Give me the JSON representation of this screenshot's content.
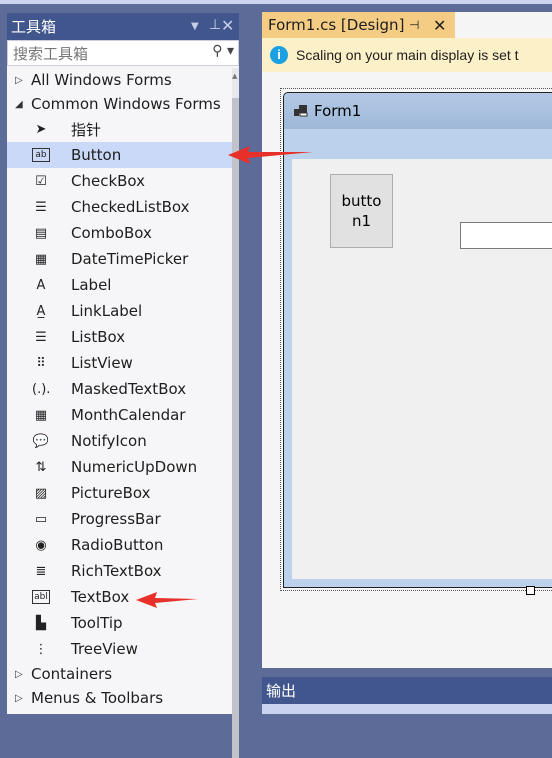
{
  "toolbox": {
    "title": "工具箱",
    "search_placeholder": "搜索工具箱",
    "groups_top": [
      {
        "label": "All Windows Forms",
        "expanded": false
      },
      {
        "label": "Common Windows Forms",
        "expanded": true
      }
    ],
    "items": [
      {
        "label": "指针",
        "icon": "pointer-icon",
        "glyph": "➤"
      },
      {
        "label": "Button",
        "icon": "button-icon",
        "glyph": "ab",
        "selected": true
      },
      {
        "label": "CheckBox",
        "icon": "checkbox-icon",
        "glyph": "☑"
      },
      {
        "label": "CheckedListBox",
        "icon": "checkedlistbox-icon",
        "glyph": "☰"
      },
      {
        "label": "ComboBox",
        "icon": "combobox-icon",
        "glyph": "▤"
      },
      {
        "label": "DateTimePicker",
        "icon": "datetimepicker-icon",
        "glyph": "▦"
      },
      {
        "label": "Label",
        "icon": "label-icon",
        "glyph": "A"
      },
      {
        "label": "LinkLabel",
        "icon": "linklabel-icon",
        "glyph": "A̲"
      },
      {
        "label": "ListBox",
        "icon": "listbox-icon",
        "glyph": "☰"
      },
      {
        "label": "ListView",
        "icon": "listview-icon",
        "glyph": "⠿"
      },
      {
        "label": "MaskedTextBox",
        "icon": "maskedtextbox-icon",
        "glyph": "(.)."
      },
      {
        "label": "MonthCalendar",
        "icon": "monthcalendar-icon",
        "glyph": "▦"
      },
      {
        "label": "NotifyIcon",
        "icon": "notifyicon-icon",
        "glyph": "💬"
      },
      {
        "label": "NumericUpDown",
        "icon": "numericupdown-icon",
        "glyph": "⇅"
      },
      {
        "label": "PictureBox",
        "icon": "picturebox-icon",
        "glyph": "▨"
      },
      {
        "label": "ProgressBar",
        "icon": "progressbar-icon",
        "glyph": "▭"
      },
      {
        "label": "RadioButton",
        "icon": "radiobutton-icon",
        "glyph": "◉"
      },
      {
        "label": "RichTextBox",
        "icon": "richtextbox-icon",
        "glyph": "≣"
      },
      {
        "label": "TextBox",
        "icon": "textbox-icon",
        "glyph": "abl"
      },
      {
        "label": "ToolTip",
        "icon": "tooltip-icon",
        "glyph": "▙"
      },
      {
        "label": "TreeView",
        "icon": "treeview-icon",
        "glyph": "⋮"
      }
    ],
    "groups_bottom": [
      {
        "label": "Containers",
        "expanded": false
      },
      {
        "label": "Menus & Toolbars",
        "expanded": false
      }
    ]
  },
  "editor": {
    "tab_label": "Form1.cs [Design]",
    "info_text": "Scaling on your main display is set t",
    "form": {
      "title": "Form1",
      "button_text": "butto\nn1"
    }
  },
  "output": {
    "title": "输出"
  },
  "colors": {
    "accent": "#40568d",
    "tab": "#f5cc84",
    "selection": "#c9d9f7",
    "arrow": "#e8302a"
  }
}
